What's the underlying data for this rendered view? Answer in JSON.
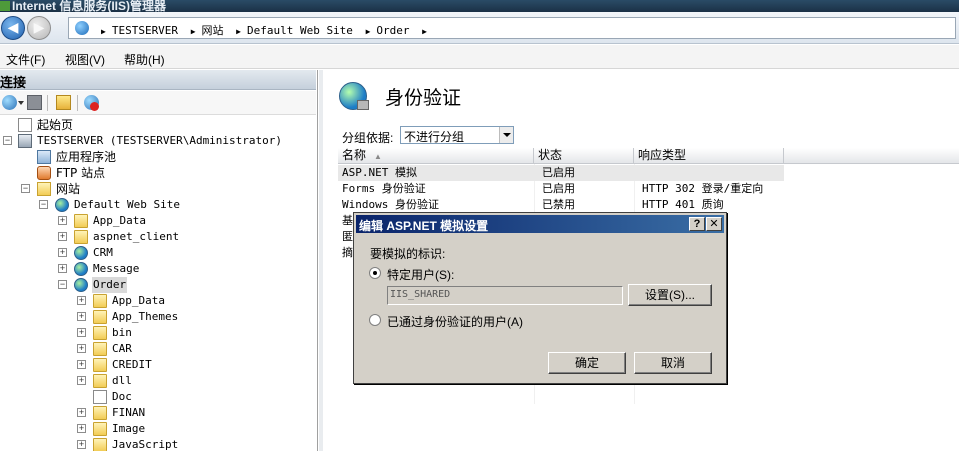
{
  "window": {
    "title": "Internet 信息服务(IIS)管理器"
  },
  "address": {
    "crumbs": [
      "TESTSERVER",
      "网站",
      "Default Web Site",
      "Order"
    ],
    "separator": "▶"
  },
  "menu": {
    "items": [
      "文件(F)",
      "视图(V)",
      "帮助(H)"
    ]
  },
  "connections": {
    "title": "连接",
    "tree": [
      {
        "label": "起始页",
        "icon": "start-page-icon"
      },
      {
        "label": "TESTSERVER (TESTSERVER\\Administrator)",
        "icon": "server-icon"
      },
      {
        "label": "应用程序池",
        "icon": "app-pool-icon"
      },
      {
        "label": "FTP 站点",
        "icon": "ftp-sites-icon"
      },
      {
        "label": "网站",
        "icon": "sites-icon"
      },
      {
        "label": "Default Web Site",
        "icon": "website-icon"
      },
      {
        "label": "App_Data",
        "icon": "folder-icon"
      },
      {
        "label": "aspnet_client",
        "icon": "folder-icon"
      },
      {
        "label": "CRM",
        "icon": "application-icon"
      },
      {
        "label": "Message",
        "icon": "application-icon"
      },
      {
        "label": "Order",
        "icon": "application-icon"
      },
      {
        "label": "App_Data",
        "icon": "folder-icon"
      },
      {
        "label": "App_Themes",
        "icon": "folder-icon"
      },
      {
        "label": "bin",
        "icon": "folder-icon"
      },
      {
        "label": "CAR",
        "icon": "folder-icon"
      },
      {
        "label": "CREDIT",
        "icon": "folder-icon"
      },
      {
        "label": "dll",
        "icon": "folder-icon"
      },
      {
        "label": "Doc",
        "icon": "page-icon"
      },
      {
        "label": "FINAN",
        "icon": "folder-icon"
      },
      {
        "label": "Image",
        "icon": "folder-icon"
      },
      {
        "label": "JavaScript",
        "icon": "folder-icon"
      }
    ]
  },
  "feature": {
    "title": "身份验证",
    "group_label": "分组依据:",
    "group_value": "不进行分组",
    "columns": [
      "名称",
      "状态",
      "响应类型"
    ],
    "rows": [
      {
        "name": "ASP.NET 模拟",
        "status": "已启用",
        "response": ""
      },
      {
        "name": "Forms 身份验证",
        "status": "已启用",
        "response": "HTTP 302 登录/重定向"
      },
      {
        "name": "Windows 身份验证",
        "status": "已禁用",
        "response": "HTTP 401 质询"
      },
      {
        "name": "基",
        "status": "",
        "response": ""
      },
      {
        "name": "匿",
        "status": "",
        "response": ""
      },
      {
        "name": "摘",
        "status": "",
        "response": ""
      }
    ]
  },
  "dialog": {
    "title": "编辑 ASP.NET 模拟设置",
    "help": "?",
    "close": "✕",
    "identity_label": "要模拟的标识:",
    "specific_user_label": "特定用户(S):",
    "specific_user_value": "IIS_SHARED",
    "set_button": "设置(S)...",
    "auth_user_label": "已通过身份验证的用户(A)",
    "ok_button": "确定",
    "cancel_button": "取消"
  }
}
